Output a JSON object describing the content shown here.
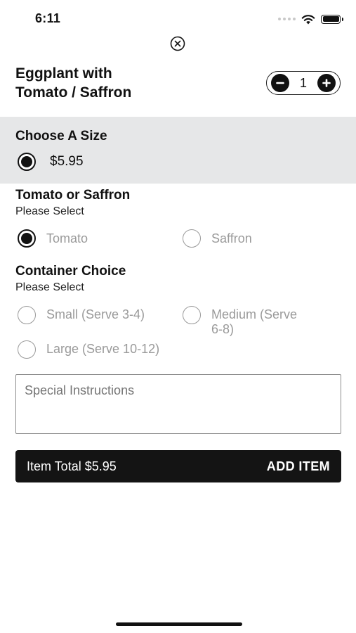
{
  "status_bar": {
    "time": "6:11"
  },
  "item": {
    "title_line1": "Eggplant with",
    "title_line2": "Tomato / Saffron"
  },
  "quantity": {
    "value": "1"
  },
  "size": {
    "title": "Choose A Size",
    "options": [
      {
        "label": "$5.95",
        "selected": true
      }
    ]
  },
  "tomato_saffron": {
    "title": "Tomato or Saffron",
    "subtitle": "Please Select",
    "options": [
      {
        "label": "Tomato",
        "selected": true
      },
      {
        "label": "Saffron",
        "selected": false
      }
    ]
  },
  "container": {
    "title": "Container Choice",
    "subtitle": "Please Select",
    "options": [
      {
        "label": "Small (Serve 3-4)",
        "selected": false
      },
      {
        "label_line1": "Medium (Serve",
        "label_line2": "6-8)",
        "selected": false
      },
      {
        "label": "Large (Serve 10-12)",
        "selected": false
      }
    ]
  },
  "special_instructions": {
    "placeholder": "Special Instructions"
  },
  "footer": {
    "total": "Item Total $5.95",
    "add_label": "ADD ITEM"
  },
  "colors": {
    "accent": "#111111",
    "section_bg": "#e6e7e8",
    "muted_text": "#9a9a9a"
  },
  "icons": {
    "close": "close-circle-icon",
    "minus": "minus-icon",
    "plus": "plus-icon",
    "wifi": "wifi-icon",
    "battery": "battery-icon"
  }
}
